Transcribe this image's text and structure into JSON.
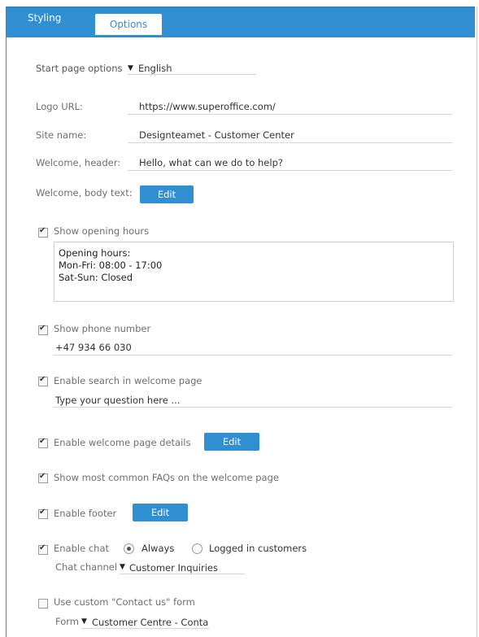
{
  "tabs": {
    "styling": "Styling",
    "options": "Options"
  },
  "start_page": {
    "label": "Start page options",
    "value": "English"
  },
  "fields": {
    "logo_url": {
      "label": "Logo URL:",
      "value": "https://www.superoffice.com/"
    },
    "site_name": {
      "label": "Site name:",
      "value": "Designteamet - Customer Center"
    },
    "welcome_header": {
      "label": "Welcome, header:",
      "value": "Hello, what can we do to help?"
    },
    "welcome_body": {
      "label": "Welcome, body text:",
      "button": "Edit"
    }
  },
  "opening_hours": {
    "label": "Show opening hours",
    "checked": true,
    "lines": [
      "Opening hours:",
      "Mon-Fri: 08:00 - 17:00",
      "Sat-Sun: Closed"
    ]
  },
  "phone": {
    "label": "Show phone number",
    "checked": true,
    "value": "+47 934 66 030"
  },
  "search": {
    "label": "Enable search in welcome page",
    "checked": true,
    "value": "Type your question here ..."
  },
  "welcome_details": {
    "label": "Enable welcome page details",
    "checked": true,
    "button": "Edit"
  },
  "faqs": {
    "label": "Show most common FAQs on the welcome page",
    "checked": true
  },
  "footer": {
    "label": "Enable footer",
    "checked": true,
    "button": "Edit"
  },
  "chat": {
    "label": "Enable chat",
    "checked": true,
    "radio_always": "Always",
    "radio_logged": "Logged in customers",
    "selected": "Always",
    "channel_label": "Chat channel",
    "channel_value": "Customer Inquiries"
  },
  "contact_form": {
    "label": "Use custom \"Contact us\" form",
    "checked": false,
    "form_label": "Form",
    "form_value": "Customer Centre - Conta"
  },
  "colors": {
    "accent": "#2f8fd1"
  }
}
